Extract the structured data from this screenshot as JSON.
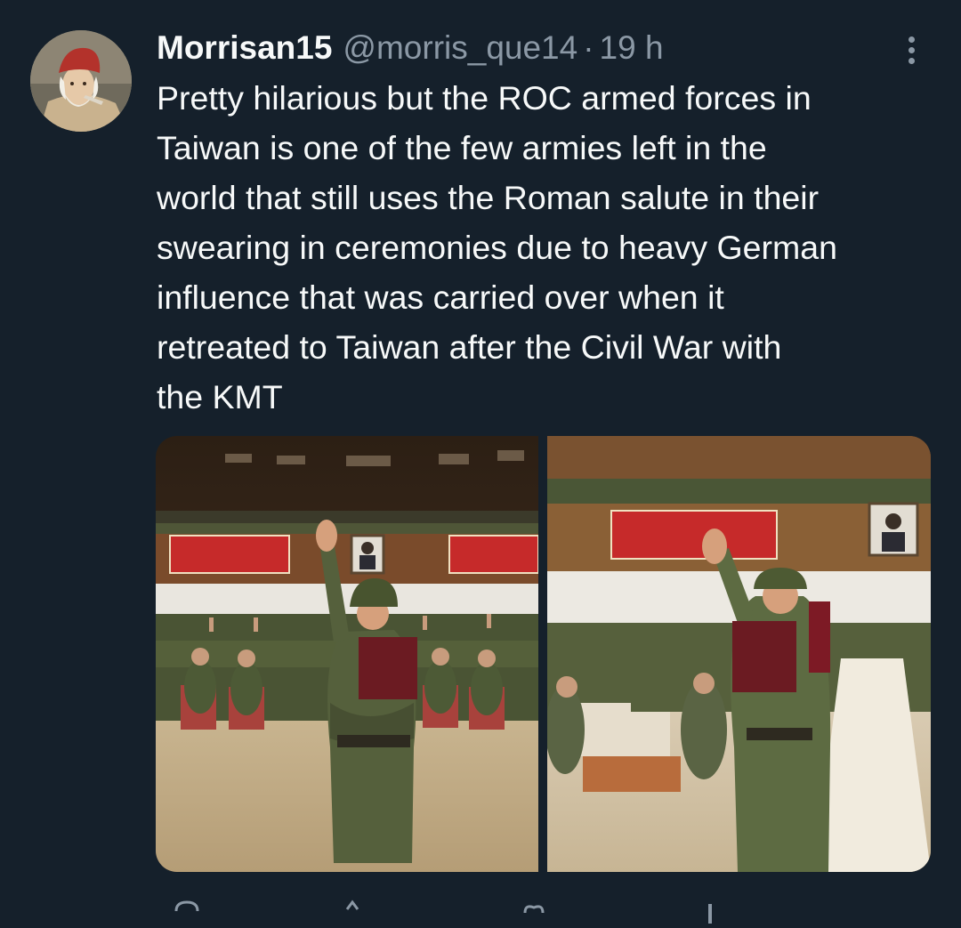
{
  "tweet": {
    "author": {
      "display_name": "Morrisan15",
      "handle": "@morris_que14",
      "avatar_icon": "avatar-portrait-red-cap"
    },
    "separator": "·",
    "time": "19 h",
    "more_icon": "more-vertical-icon",
    "text_lines": [
      "Pretty hilarious but the ROC armed forces in",
      "Taiwan is one of the few armies left in the",
      "world that still uses the Roman salute in their",
      "swearing in ceremonies due to heavy German",
      "influence that was carried over when it",
      "retreated to Taiwan after the Civil War with",
      "the KMT"
    ],
    "media": [
      {
        "icon": "photo-ceremony-soldier-reading-oath"
      },
      {
        "icon": "photo-ceremony-soldier-raised-hand"
      }
    ],
    "actions": [
      "reply-icon",
      "retweet-icon",
      "like-icon",
      "views-icon",
      "share-icon"
    ]
  },
  "colors": {
    "background": "#15202b",
    "primary_text": "#f7f9f9",
    "secondary_text": "#8b98a5"
  }
}
